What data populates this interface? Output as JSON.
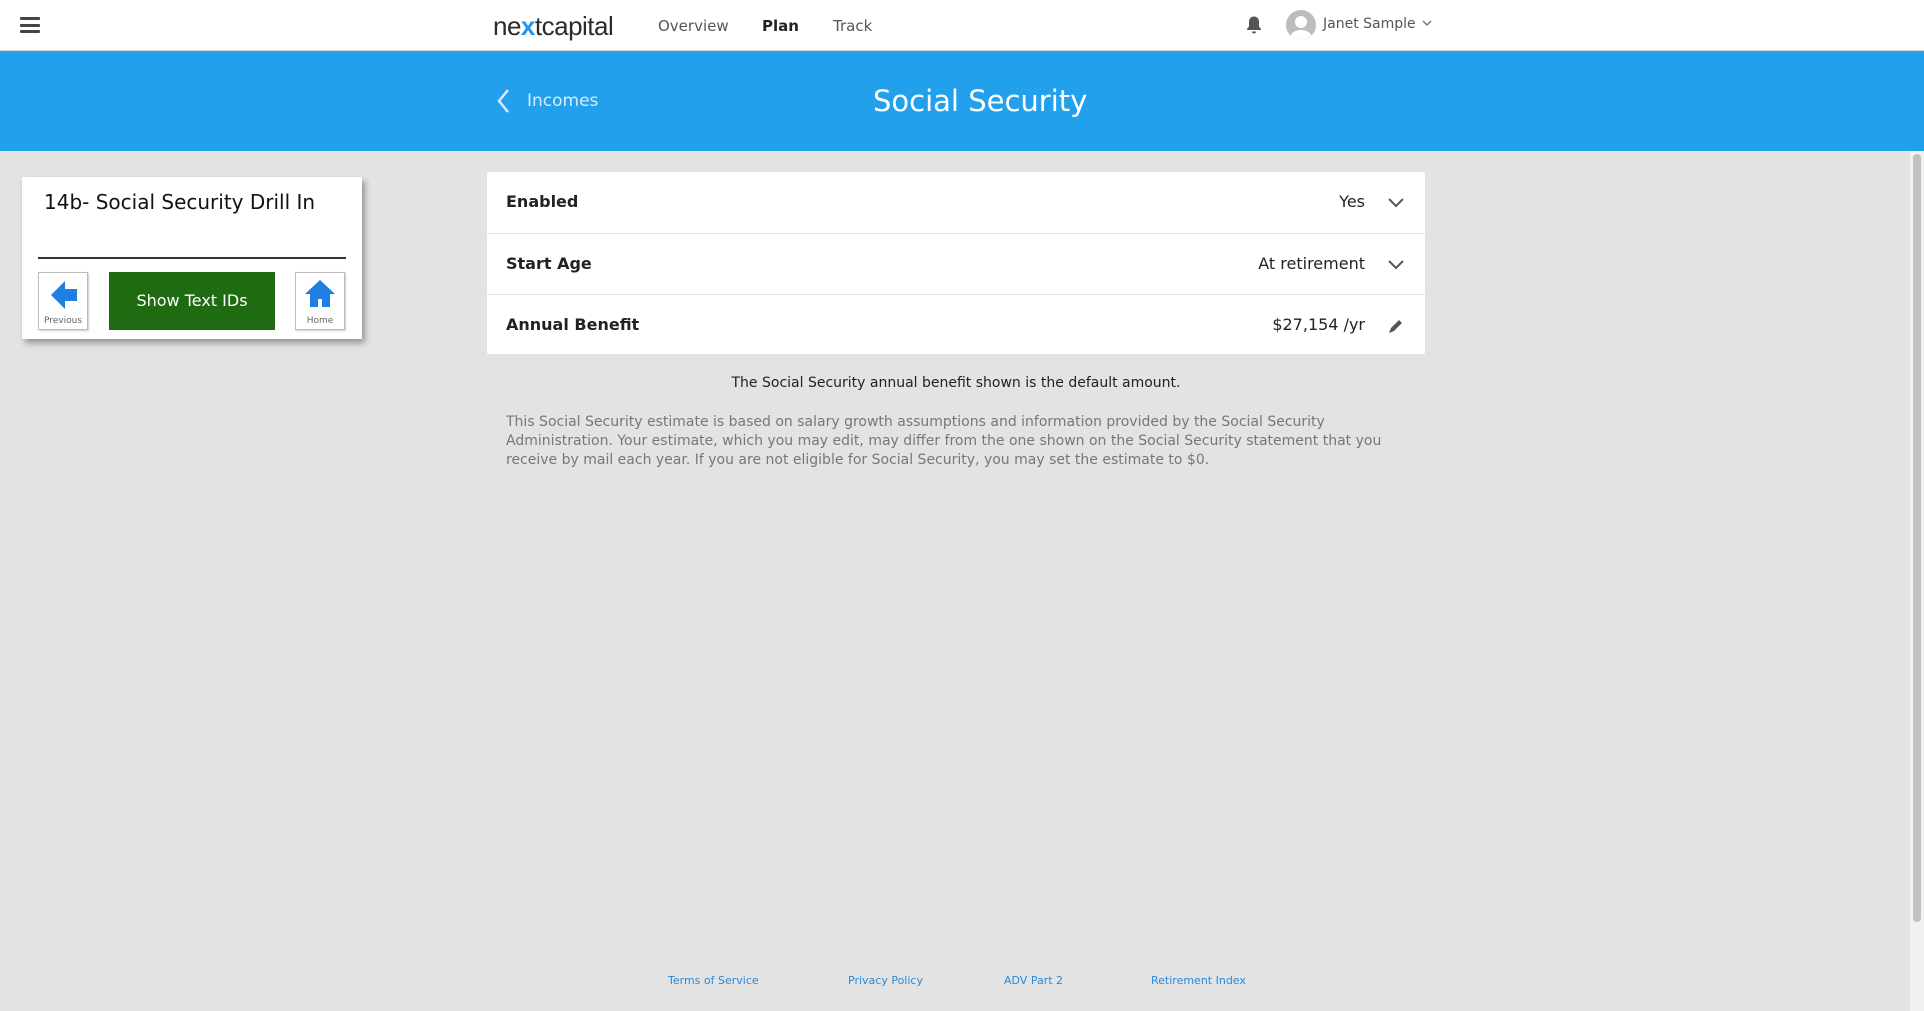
{
  "header": {
    "logo_prefix": "ne",
    "logo_x": "x",
    "logo_suffix": "tcapital",
    "nav": [
      {
        "label": "Overview"
      },
      {
        "label": "Plan"
      },
      {
        "label": "Track"
      }
    ],
    "active_nav": "Plan",
    "user_name": "Janet Sample"
  },
  "banner": {
    "back_label": "Incomes",
    "title": "Social Security"
  },
  "widget": {
    "title": "14b- Social Security Drill In",
    "previous_label": "Previous",
    "show_ids_label": "Show Text IDs",
    "home_label": "Home"
  },
  "settings": {
    "rows": [
      {
        "label": "Enabled",
        "value": "Yes",
        "icon": "chevron-down-icon"
      },
      {
        "label": "Start Age",
        "value": "At retirement",
        "icon": "chevron-down-icon"
      },
      {
        "label": "Annual Benefit",
        "value": "$27,154 /yr",
        "icon": "pencil-icon"
      }
    ]
  },
  "note": "The Social Security annual benefit shown is the default amount.",
  "disclaimer": "This Social Security estimate is based on salary growth assumptions and information provided by the Social Security Administration. Your estimate, which you may edit, may differ from the one shown on the Social Security statement that you receive by mail each year. If you are not eligible for Social Security, you may set the estimate to $0.",
  "footer": {
    "links": [
      {
        "label": "Terms of Service"
      },
      {
        "label": "Privacy Policy"
      },
      {
        "label": "ADV Part 2"
      },
      {
        "label": "Retirement Index"
      }
    ]
  },
  "colors": {
    "banner": "#22a0ec",
    "accent": "#2196f3",
    "show_ids_button": "#1f6b12",
    "page_background": "#e3e3e3"
  }
}
